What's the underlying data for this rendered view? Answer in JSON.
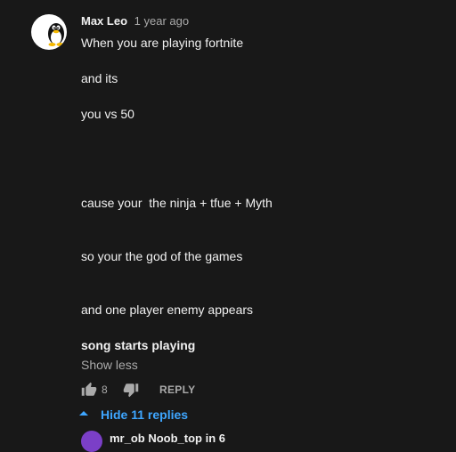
{
  "comment": {
    "author": "Max Leo",
    "timestamp": "1 year ago",
    "lines": [
      "When you are playing fortnite",
      "and its",
      "you vs 50",
      "cause your  the ninja + tfue + Myth",
      "so your the god of the games",
      "and one player enemy appears",
      "song starts playing"
    ],
    "show_less_label": "Show less",
    "like_count": "8",
    "reply_label": "REPLY",
    "hide_replies_label": "Hide 11 replies"
  },
  "reply_preview": {
    "author": "mr_ob Noob_top in 6"
  },
  "colors": {
    "background": "#181818",
    "text": "#f1f1f1",
    "secondary": "#aaaaaa",
    "link": "#3ea6ff",
    "reply_avatar": "#7b3fc7"
  },
  "icons": {
    "avatar": "linux-penguin-icon",
    "like": "thumbs-up-icon",
    "dislike": "thumbs-down-icon",
    "caret": "caret-up-icon"
  }
}
